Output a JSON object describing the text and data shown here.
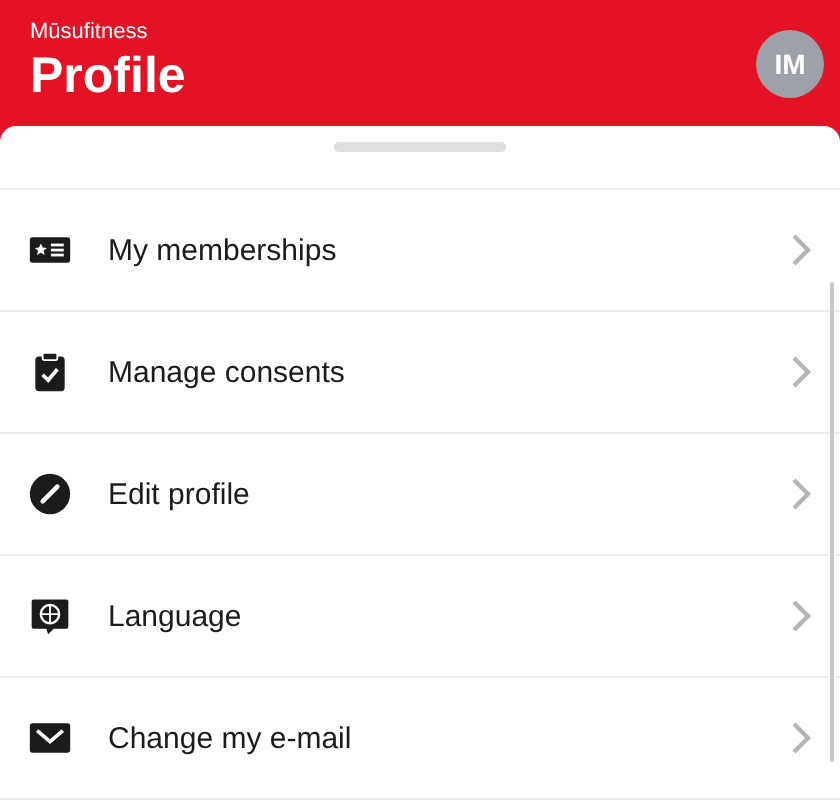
{
  "header": {
    "brand": "Mūsufitness",
    "title": "Profile",
    "avatar": "IM"
  },
  "menu": [
    {
      "label": "My memberships"
    },
    {
      "label": "Manage consents"
    },
    {
      "label": "Edit profile"
    },
    {
      "label": "Language"
    },
    {
      "label": "Change my e-mail"
    }
  ]
}
